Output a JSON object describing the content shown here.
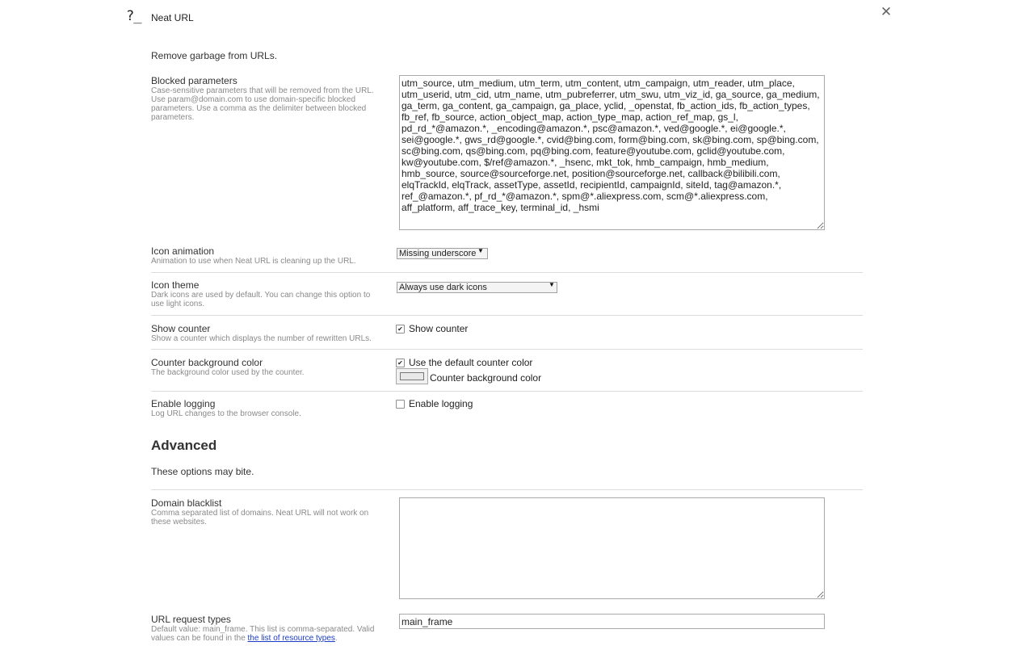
{
  "header": {
    "icon_glyph": "?_",
    "title": "Neat URL",
    "close_glyph": "✕"
  },
  "intro": "Remove garbage from URLs.",
  "blocked": {
    "label": "Blocked parameters",
    "desc": "Case-sensitive parameters that will be removed from the URL. Use param@domain.com to use domain-specific blocked parameters. Use a comma as the delimiter between blocked parameters.",
    "value": "utm_source, utm_medium, utm_term, utm_content, utm_campaign, utm_reader, utm_place, utm_userid, utm_cid, utm_name, utm_pubreferrer, utm_swu, utm_viz_id, ga_source, ga_medium, ga_term, ga_content, ga_campaign, ga_place, yclid, _openstat, fb_action_ids, fb_action_types, fb_ref, fb_source, action_object_map, action_type_map, action_ref_map, gs_l, pd_rd_*@amazon.*, _encoding@amazon.*, psc@amazon.*, ved@google.*, ei@google.*, sei@google.*, gws_rd@google.*, cvid@bing.com, form@bing.com, sk@bing.com, sp@bing.com, sc@bing.com, qs@bing.com, pq@bing.com, feature@youtube.com, gclid@youtube.com, kw@youtube.com, $/ref@amazon.*, _hsenc, mkt_tok, hmb_campaign, hmb_medium, hmb_source, source@sourceforge.net, position@sourceforge.net, callback@bilibili.com, elqTrackId, elqTrack, assetType, assetId, recipientId, campaignId, siteId, tag@amazon.*, ref_@amazon.*, pf_rd_*@amazon.*, spm@*.aliexpress.com, scm@*.aliexpress.com, aff_platform, aff_trace_key, terminal_id, _hsmi"
  },
  "animation": {
    "label": "Icon animation",
    "desc": "Animation to use when Neat URL is cleaning up the URL.",
    "selected": "Missing underscore"
  },
  "theme": {
    "label": "Icon theme",
    "desc": "Dark icons are used by default. You can change this option to use light icons.",
    "selected": "Always use dark icons"
  },
  "counter": {
    "label": "Show counter",
    "desc": "Show a counter which displays the number of rewritten URLs.",
    "checkbox_label": "Show counter",
    "checked": true
  },
  "counter_bg": {
    "label": "Counter background color",
    "desc": "The background color used by the counter.",
    "checkbox_label": "Use the default counter color",
    "checked": true,
    "color_label": "Counter background color",
    "swatch_color": "#e8e8e8"
  },
  "logging": {
    "label": "Enable logging",
    "desc": "Log URL changes to the browser console.",
    "checkbox_label": "Enable logging",
    "checked": false
  },
  "advanced": {
    "title": "Advanced",
    "subtitle": "These options may bite."
  },
  "blacklist": {
    "label": "Domain blacklist",
    "desc": "Comma separated list of domains. Neat URL will not work on these websites.",
    "value": ""
  },
  "request_types": {
    "label": "URL request types",
    "desc_prefix": "Default value: main_frame. This list is comma-separated. Valid values can be found in the ",
    "link_text": "the list of resource types",
    "desc_suffix": ".",
    "value": "main_frame"
  },
  "colors": {
    "link": "#1a3cc6",
    "separator": "#dcdcdc",
    "description": "#8a8a8a"
  }
}
